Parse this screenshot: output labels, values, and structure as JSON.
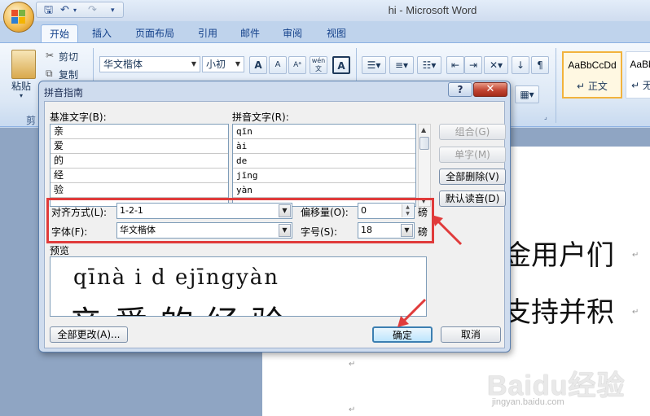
{
  "window": {
    "title": "hi - Microsoft Word"
  },
  "qat": {
    "save_icon": "save-icon",
    "undo_icon": "undo-icon",
    "redo_icon": "redo-icon",
    "customize_icon": "customize-icon"
  },
  "ribbon": {
    "tabs": [
      {
        "label": "开始",
        "active": true
      },
      {
        "label": "插入"
      },
      {
        "label": "页面布局"
      },
      {
        "label": "引用"
      },
      {
        "label": "邮件"
      },
      {
        "label": "审阅"
      },
      {
        "label": "视图"
      }
    ],
    "clipboard": {
      "paste": "粘贴",
      "cut": "剪切",
      "copy": "复制",
      "group": "剪"
    },
    "font": {
      "name": "华文楷体",
      "size": "小初",
      "grow": "A",
      "shrink": "A",
      "pinyin_guide": "wén",
      "border_char": "A"
    },
    "styles": [
      {
        "sample": "AaBbCcDd",
        "label": "正文",
        "active": true
      },
      {
        "sample": "AaBb",
        "label": "无"
      }
    ]
  },
  "document": {
    "line1": "金用户们",
    "line2": "支持并积",
    "watermark": "Baidu经验",
    "watermark_url": "jingyan.baidu.com"
  },
  "dialog": {
    "title": "拼音指南",
    "help": "?",
    "close": "✕",
    "col_base": "基准文字(B):",
    "col_pinyin": "拼音文字(R):",
    "rows": [
      {
        "base": "亲",
        "pinyin": "qīn"
      },
      {
        "base": "爱",
        "pinyin": "ài"
      },
      {
        "base": "的",
        "pinyin": "de"
      },
      {
        "base": "经",
        "pinyin": "jīng"
      },
      {
        "base": "验",
        "pinyin": "yàn"
      }
    ],
    "buttons": {
      "combine": "组合(G)",
      "single": "单字(M)",
      "clear_all": "全部删除(V)",
      "default_reading": "默认读音(D)",
      "apply_all": "全部更改(A)...",
      "ok": "确定",
      "cancel": "取消"
    },
    "alignment_label": "对齐方式(L):",
    "alignment_value": "1-2-1",
    "offset_label": "偏移量(O):",
    "offset_value": "0",
    "offset_unit": "磅",
    "font_label": "字体(F):",
    "font_value": "华文楷体",
    "size_label": "字号(S):",
    "size_value": "18",
    "size_unit": "磅",
    "preview_label": "预览",
    "preview_pinyin": "qīnà i d ejīngyàn",
    "preview_base": "亲爱的经验"
  },
  "colors": {
    "accent_red": "#e03b3b",
    "ribbon_blue": "#bfd3ec"
  }
}
